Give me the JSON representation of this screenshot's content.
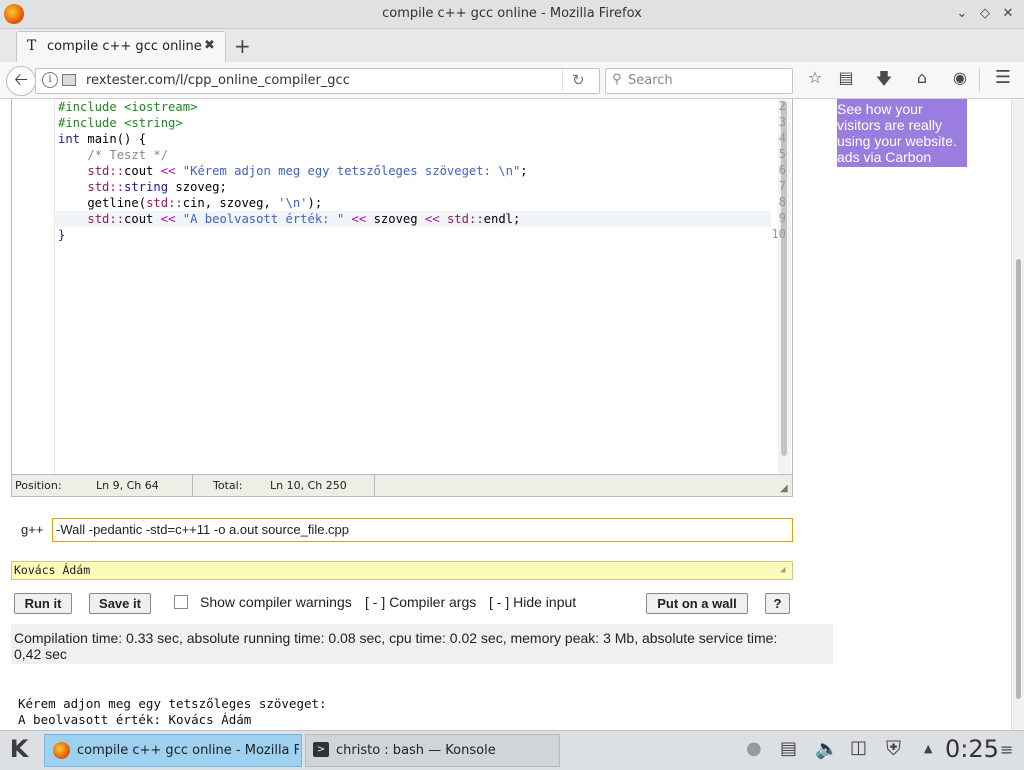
{
  "window": {
    "title": "compile c++ gcc online - Mozilla Firefox"
  },
  "tab": {
    "label": "compile c++ gcc online",
    "favicon": "T"
  },
  "navbar": {
    "url": "rextester.com/l/cpp_online_compiler_gcc",
    "search_placeholder": "Search"
  },
  "editor": {
    "lines": [
      {
        "n": "2",
        "html": "<span class='pp'>#include &lt;iostream&gt;</span>"
      },
      {
        "n": "3",
        "html": "<span class='pp'>#include &lt;string&gt;</span>"
      },
      {
        "n": "4",
        "html": "<span class='kw'>int</span> main() {"
      },
      {
        "n": "5",
        "html": "    <span class='cm'>/* Teszt */</span>"
      },
      {
        "n": "6",
        "html": "    <span class='ns'>std::</span>cout <span class='op'>&lt;&lt;</span> <span class='st'>\"Kérem adjon meg egy tetszőleges szöveget: \\n\"</span>;"
      },
      {
        "n": "7",
        "html": "    <span class='ns'>std::</span><span class='kw'>string</span> szoveg;"
      },
      {
        "n": "8",
        "html": "    getline(<span class='ns'>std::</span>cin, szoveg, <span class='st'>'\\n'</span>);"
      },
      {
        "n": "9",
        "html": "    <span class='ns'>std::</span>cout <span class='op'>&lt;&lt;</span> <span class='st'>\"A beolvasott érték: \"</span> <span class='op'>&lt;&lt;</span> szoveg <span class='op'>&lt;&lt;</span> <span class='ns'>std::</span>endl;"
      },
      {
        "n": "10",
        "html": "<span class='kw'>}</span>"
      }
    ]
  },
  "status": {
    "position_label": "Position:",
    "position_value": "Ln 9, Ch 64",
    "total_label": "Total:",
    "total_value": "Ln 10, Ch 250"
  },
  "compiler": {
    "label": "g++",
    "args": "-Wall -pedantic -std=c++11 -o a.out source_file.cpp"
  },
  "stdin": {
    "value": "Kovács Ádám"
  },
  "controls": {
    "run": "Run it",
    "save": "Save it",
    "show_warnings": "Show compiler warnings",
    "compiler_args": "[ - ] Compiler args",
    "hide_input": "[ - ] Hide input",
    "wall": "Put on a wall",
    "help": "?"
  },
  "result": {
    "stats": "Compilation time: 0.33 sec, absolute running time: 0.08 sec, cpu time: 0.02 sec, memory peak: 3 Mb, absolute service time: 0,42 sec"
  },
  "output": {
    "line1": "Kérem adjon meg egy tetszőleges szöveget:",
    "line2": "A beolvasott érték: Kovács Ádám"
  },
  "ad": {
    "text": "See how your visitors are really using your website. ads via Carbon"
  },
  "taskbar": {
    "task1": "compile c++ gcc online - Mozilla Fire",
    "task2": "christo : bash — Konsole",
    "clock": "0:25"
  }
}
